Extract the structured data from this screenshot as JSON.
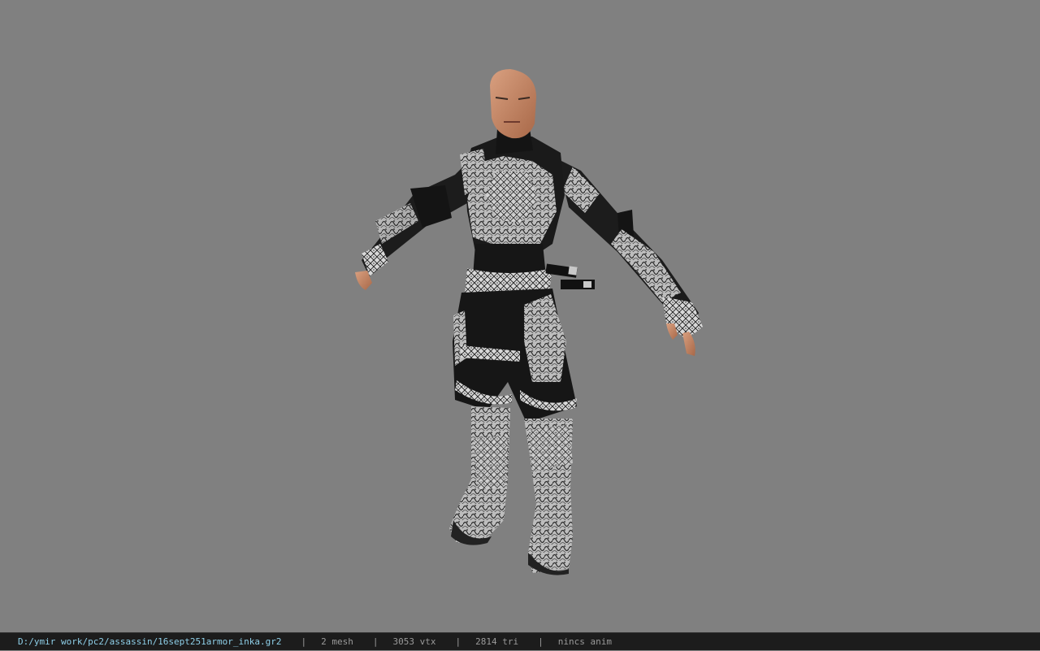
{
  "viewport": {
    "background": "#808080",
    "model": "armored-character-model"
  },
  "status_bar": {
    "file_path": "D:/ymir work/pc2/assassin/16sept251armor_inka.gr2",
    "separator": "|",
    "mesh_count": "2 mesh",
    "vertex_count": "3053 vtx",
    "triangle_count": "2814 tri",
    "anim_status": "nincs anim",
    "path_color": "#8ecfe8",
    "text_color": "#9a9a9a"
  }
}
